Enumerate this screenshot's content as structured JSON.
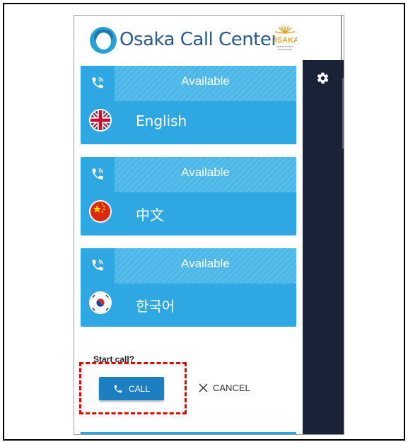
{
  "header": {
    "app_name": "Osaka Call Center"
  },
  "cards": [
    {
      "status": "Available",
      "language": "English",
      "flag_icon": "uk-flag-icon"
    },
    {
      "status": "Available",
      "language": "中文",
      "flag_icon": "china-flag-icon"
    },
    {
      "status": "Available",
      "language": "한국어",
      "flag_icon": "korea-flag-icon"
    }
  ],
  "prompt": {
    "question": "Start call?",
    "call_label": "CALL",
    "cancel_label": "CANCEL"
  },
  "colors": {
    "card": "#2ea7e2",
    "call_button": "#1b7fc2",
    "sidebar": "#1a2238",
    "highlight": "#e30000"
  }
}
